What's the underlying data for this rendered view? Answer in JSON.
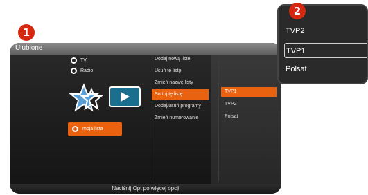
{
  "badges": {
    "first": "1",
    "second": "2"
  },
  "header": {
    "title": "Ulubione"
  },
  "left": {
    "options": [
      {
        "label": "TV",
        "selected": true
      },
      {
        "label": "Radio",
        "selected": false
      }
    ],
    "list_button": "moja lista"
  },
  "menu": {
    "items": [
      {
        "label": "Dodaj nową listę",
        "active": false
      },
      {
        "label": "Usuń tę listę",
        "active": false
      },
      {
        "label": "Zmień nazwę listy",
        "active": false
      },
      {
        "label": "Sortuj tę listę",
        "active": true
      },
      {
        "label": "Dodaj/usuń programy",
        "active": false
      },
      {
        "label": "Zmień numerowanie",
        "active": false
      }
    ]
  },
  "submenu": {
    "items": [
      {
        "label": "TVP1",
        "active": true
      },
      {
        "label": "TVP2",
        "active": false
      },
      {
        "label": "Polsat",
        "active": false
      }
    ]
  },
  "footer": {
    "hint": "Naciśnij Opt po więcej opcji"
  },
  "popup": {
    "items": [
      {
        "label": "TVP2",
        "active": false
      },
      {
        "label": "TVP1",
        "active": true
      },
      {
        "label": "Polsat",
        "active": false
      }
    ]
  },
  "colors": {
    "accent": "#e8620f",
    "badge": "#d6280f"
  }
}
